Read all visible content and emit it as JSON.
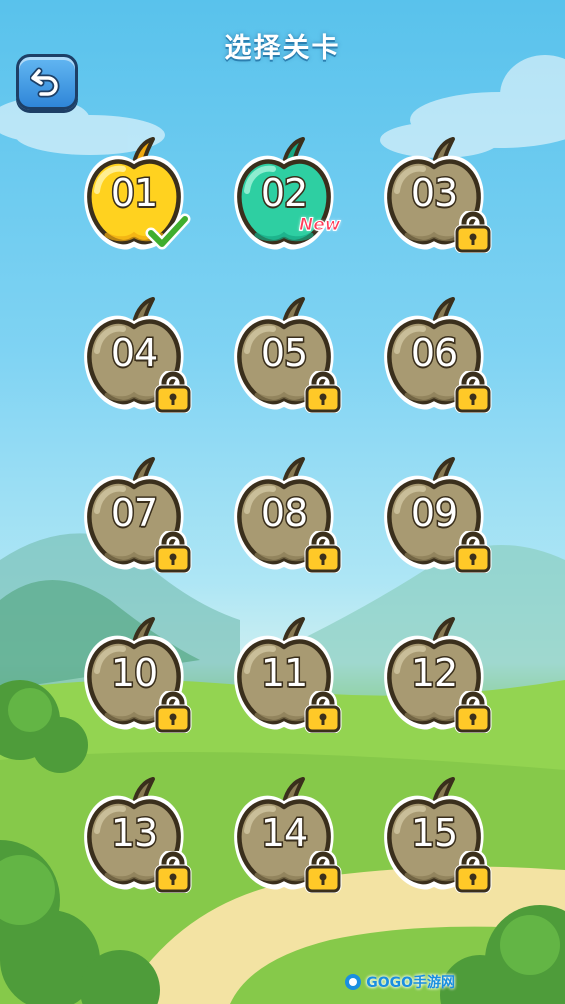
{
  "header": {
    "title": "选择关卡"
  },
  "back_button": {
    "icon": "undo-arrow-icon"
  },
  "colors": {
    "sky": "#59c2ec",
    "grass": "#86cc4a",
    "apple_completed": "#ffd21f",
    "apple_current": "#2ecfa2",
    "apple_locked": "#a89a72",
    "outline": "#3a2f1c"
  },
  "levels": [
    {
      "label": "01",
      "state": "completed",
      "icon": "checkmark-icon"
    },
    {
      "label": "02",
      "state": "current",
      "badge": "New"
    },
    {
      "label": "03",
      "state": "locked",
      "icon": "lock-icon"
    },
    {
      "label": "04",
      "state": "locked",
      "icon": "lock-icon"
    },
    {
      "label": "05",
      "state": "locked",
      "icon": "lock-icon"
    },
    {
      "label": "06",
      "state": "locked",
      "icon": "lock-icon"
    },
    {
      "label": "07",
      "state": "locked",
      "icon": "lock-icon"
    },
    {
      "label": "08",
      "state": "locked",
      "icon": "lock-icon"
    },
    {
      "label": "09",
      "state": "locked",
      "icon": "lock-icon"
    },
    {
      "label": "10",
      "state": "locked",
      "icon": "lock-icon"
    },
    {
      "label": "11",
      "state": "locked",
      "icon": "lock-icon"
    },
    {
      "label": "12",
      "state": "locked",
      "icon": "lock-icon"
    },
    {
      "label": "13",
      "state": "locked",
      "icon": "lock-icon"
    },
    {
      "label": "14",
      "state": "locked",
      "icon": "lock-icon"
    },
    {
      "label": "15",
      "state": "locked",
      "icon": "lock-icon"
    }
  ],
  "watermark": {
    "text": "GOGO手游网"
  }
}
